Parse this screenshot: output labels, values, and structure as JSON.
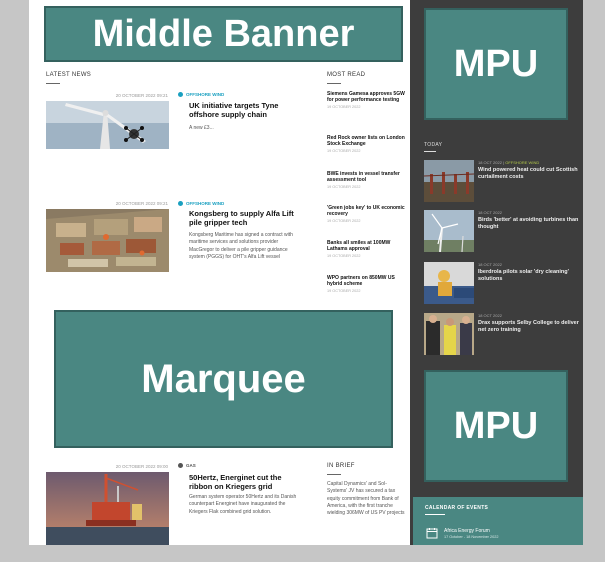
{
  "banners": {
    "middle": "Middle Banner",
    "marquee": "Marquee",
    "mpu_top": "MPU",
    "mpu_bottom": "MPU"
  },
  "latest_news": {
    "label": "LATEST NEWS",
    "articles": [
      {
        "date": "20 OCTOBER 2022 09:21",
        "tag": "OFFSHORE WIND",
        "headline": "UK initiative targets Tyne offshore supply chain",
        "summary": "A new £3..."
      },
      {
        "date": "20 OCTOBER 2022 09:21",
        "tag": "OFFSHORE WIND",
        "headline": "Kongsberg to supply Alfa Lift pile gripper tech",
        "summary": "Kongsberg Maritime has signed a contract with maritime services and solutions provider MacGregor to deliver a pile gripper guidance system (PGGS) for OHT's Alfa Lift vessel"
      },
      {
        "date": "20 OCTOBER 2022 09:00",
        "tag": "GAS",
        "headline": "50Hertz, Energinet cut the ribbon on Kriegers grid",
        "summary": "German system operator 50Hertz and its Danish counterpart Energinet have inaugurated the Kriegers Flak combined grid solution."
      }
    ]
  },
  "most_read": {
    "label": "MOST READ",
    "items": [
      {
        "title": "Siemens Gamesa approves 5GW for power performance testing",
        "date": "19 OCTOBER 2022"
      },
      {
        "title": "Red Rock owner lists on London Stock Exchange",
        "date": "19 OCTOBER 2022"
      },
      {
        "title": "BWE invests in vessel transfer assessment tool",
        "date": "19 OCTOBER 2022"
      },
      {
        "title": "'Green jobs key' to UK economic recovery",
        "date": "19 OCTOBER 2022"
      },
      {
        "title": "Banks all smiles at 100MW Lathams approval",
        "date": "19 OCTOBER 2022"
      },
      {
        "title": "WPO partners on 850MW US hybrid scheme",
        "date": "19 OCTOBER 2022"
      }
    ]
  },
  "in_brief": {
    "label": "IN BRIEF",
    "text": "Capital Dynamics' and Sol-Systems' JV has secured a tax equity commitment from Bank of America, with the first tranche wielding 306MW of US PV projects"
  },
  "sidebar": {
    "label": "TODAY",
    "items": [
      {
        "meta": "18 OCT 2022 |",
        "meta_hi": "OFFSHORE WIND",
        "title": "Wind powered heat could cut Scottish curtailment costs"
      },
      {
        "meta": "18 OCT 2022",
        "meta_hi": "",
        "title": "Birds 'better' at avoiding turbines than thought"
      },
      {
        "meta": "18 OCT 2022",
        "meta_hi": "",
        "title": "Iberdrola pilots solar 'dry cleaning' solutions"
      },
      {
        "meta": "18 OCT 2022",
        "meta_hi": "",
        "title": "Drax supports Selby College to deliver net zero training"
      }
    ]
  },
  "calendar": {
    "label": "CALENDAR OF EVENTS",
    "event_name": "Africa Energy Forum",
    "event_date": "17 October - 18 November 2022"
  },
  "colors": {
    "teal": "#4a8782",
    "sidebar_bg": "#3d3d3d",
    "tag_blue": "#1aa0c0",
    "frame_grey": "#c6c6c6"
  }
}
